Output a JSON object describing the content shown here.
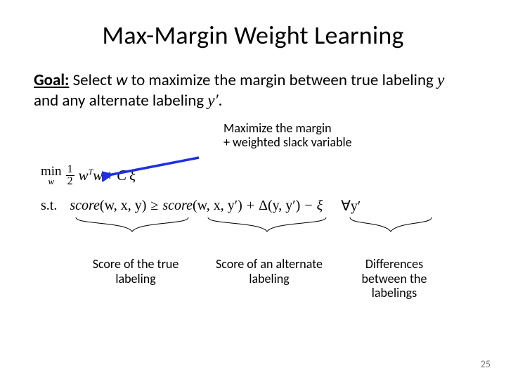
{
  "title": "Max-Margin Weight Learning",
  "goal": {
    "label": "Goal:",
    "pre": "Select ",
    "var_w": "w",
    "mid": " to maximize the margin between true labeling ",
    "sym_y": "y",
    "mid2": " and any alternate labeling ",
    "sym_yprime": "y′",
    "end": "."
  },
  "annot_top": {
    "line1": "Maximize the margin",
    "line2": "+ weighted slack variable"
  },
  "math": {
    "min": "min",
    "min_sub": "w",
    "frac_n": "1",
    "frac_d": "2",
    "wTw": "w",
    "wT_sup": "T",
    "wTw2": "w",
    "plus": " + ",
    "C": "C",
    "xi": "ξ",
    "st": "s.t.",
    "score": "score",
    "args1": "(w, x, y)",
    "geq": "≥",
    "args2": "(w, x, y′)",
    "plus2": " + ",
    "delta": "Δ(y, y′)",
    "minus": " − ",
    "xi2": "ξ",
    "forall": "∀y′"
  },
  "captions": {
    "c1": "Score of the true labeling",
    "c2": "Score of an alternate labeling",
    "c3": "Differences between the labelings"
  },
  "page": "25"
}
